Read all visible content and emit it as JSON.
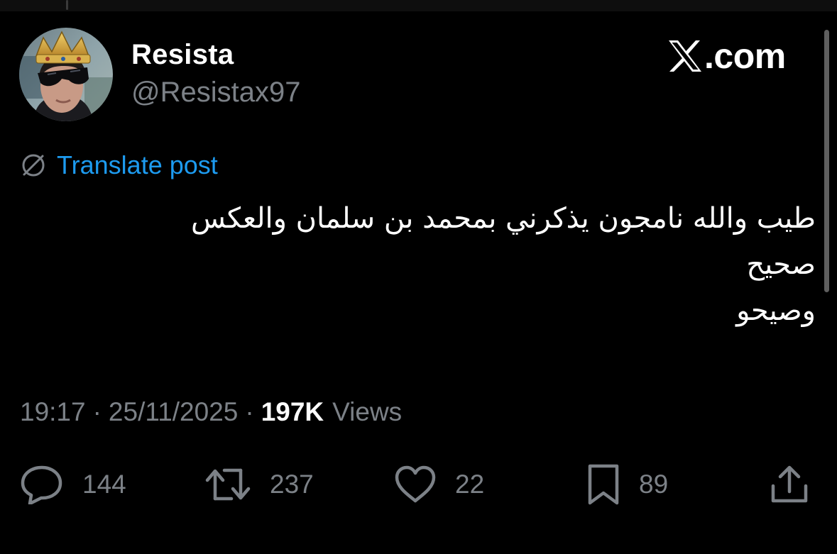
{
  "author": {
    "display_name": "Resista",
    "handle": "@Resistax97",
    "avatar_icon": "crowned-person-avatar"
  },
  "brand": {
    "text": ".com",
    "logo_icon": "x-logo"
  },
  "translate": {
    "label": "Translate post",
    "icon": "globe-icon",
    "color": "#1d9bf0"
  },
  "tweet": {
    "lines": [
      "طيب والله نامجون يذكرني بمحمد بن سلمان والعكس",
      "صحيح",
      "وصيحو"
    ]
  },
  "meta": {
    "time": "19:17",
    "separator": "·",
    "date": "25/11/2025",
    "views_count": "197K",
    "views_label": "Views"
  },
  "actions": {
    "reply_count": "144",
    "repost_count": "237",
    "like_count": "22",
    "bookmark_count": "89"
  },
  "colors": {
    "background": "#000000",
    "text_primary": "#ffffff",
    "text_secondary": "#7c8187",
    "accent": "#1d9bf0"
  }
}
